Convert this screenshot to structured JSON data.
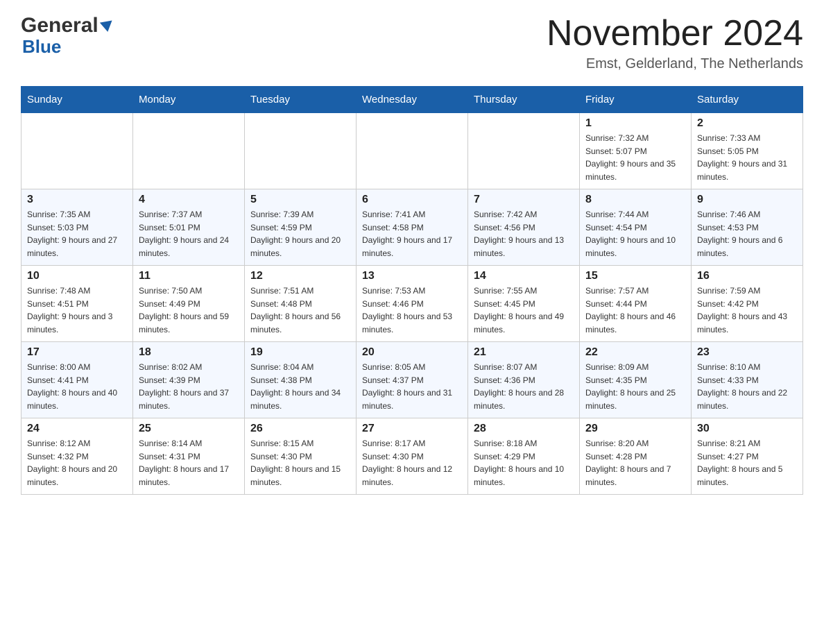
{
  "header": {
    "logo_general": "General",
    "logo_blue": "Blue",
    "month_title": "November 2024",
    "location": "Emst, Gelderland, The Netherlands"
  },
  "weekdays": [
    "Sunday",
    "Monday",
    "Tuesday",
    "Wednesday",
    "Thursday",
    "Friday",
    "Saturday"
  ],
  "rows": [
    [
      {
        "day": "",
        "sunrise": "",
        "sunset": "",
        "daylight": ""
      },
      {
        "day": "",
        "sunrise": "",
        "sunset": "",
        "daylight": ""
      },
      {
        "day": "",
        "sunrise": "",
        "sunset": "",
        "daylight": ""
      },
      {
        "day": "",
        "sunrise": "",
        "sunset": "",
        "daylight": ""
      },
      {
        "day": "",
        "sunrise": "",
        "sunset": "",
        "daylight": ""
      },
      {
        "day": "1",
        "sunrise": "Sunrise: 7:32 AM",
        "sunset": "Sunset: 5:07 PM",
        "daylight": "Daylight: 9 hours and 35 minutes."
      },
      {
        "day": "2",
        "sunrise": "Sunrise: 7:33 AM",
        "sunset": "Sunset: 5:05 PM",
        "daylight": "Daylight: 9 hours and 31 minutes."
      }
    ],
    [
      {
        "day": "3",
        "sunrise": "Sunrise: 7:35 AM",
        "sunset": "Sunset: 5:03 PM",
        "daylight": "Daylight: 9 hours and 27 minutes."
      },
      {
        "day": "4",
        "sunrise": "Sunrise: 7:37 AM",
        "sunset": "Sunset: 5:01 PM",
        "daylight": "Daylight: 9 hours and 24 minutes."
      },
      {
        "day": "5",
        "sunrise": "Sunrise: 7:39 AM",
        "sunset": "Sunset: 4:59 PM",
        "daylight": "Daylight: 9 hours and 20 minutes."
      },
      {
        "day": "6",
        "sunrise": "Sunrise: 7:41 AM",
        "sunset": "Sunset: 4:58 PM",
        "daylight": "Daylight: 9 hours and 17 minutes."
      },
      {
        "day": "7",
        "sunrise": "Sunrise: 7:42 AM",
        "sunset": "Sunset: 4:56 PM",
        "daylight": "Daylight: 9 hours and 13 minutes."
      },
      {
        "day": "8",
        "sunrise": "Sunrise: 7:44 AM",
        "sunset": "Sunset: 4:54 PM",
        "daylight": "Daylight: 9 hours and 10 minutes."
      },
      {
        "day": "9",
        "sunrise": "Sunrise: 7:46 AM",
        "sunset": "Sunset: 4:53 PM",
        "daylight": "Daylight: 9 hours and 6 minutes."
      }
    ],
    [
      {
        "day": "10",
        "sunrise": "Sunrise: 7:48 AM",
        "sunset": "Sunset: 4:51 PM",
        "daylight": "Daylight: 9 hours and 3 minutes."
      },
      {
        "day": "11",
        "sunrise": "Sunrise: 7:50 AM",
        "sunset": "Sunset: 4:49 PM",
        "daylight": "Daylight: 8 hours and 59 minutes."
      },
      {
        "day": "12",
        "sunrise": "Sunrise: 7:51 AM",
        "sunset": "Sunset: 4:48 PM",
        "daylight": "Daylight: 8 hours and 56 minutes."
      },
      {
        "day": "13",
        "sunrise": "Sunrise: 7:53 AM",
        "sunset": "Sunset: 4:46 PM",
        "daylight": "Daylight: 8 hours and 53 minutes."
      },
      {
        "day": "14",
        "sunrise": "Sunrise: 7:55 AM",
        "sunset": "Sunset: 4:45 PM",
        "daylight": "Daylight: 8 hours and 49 minutes."
      },
      {
        "day": "15",
        "sunrise": "Sunrise: 7:57 AM",
        "sunset": "Sunset: 4:44 PM",
        "daylight": "Daylight: 8 hours and 46 minutes."
      },
      {
        "day": "16",
        "sunrise": "Sunrise: 7:59 AM",
        "sunset": "Sunset: 4:42 PM",
        "daylight": "Daylight: 8 hours and 43 minutes."
      }
    ],
    [
      {
        "day": "17",
        "sunrise": "Sunrise: 8:00 AM",
        "sunset": "Sunset: 4:41 PM",
        "daylight": "Daylight: 8 hours and 40 minutes."
      },
      {
        "day": "18",
        "sunrise": "Sunrise: 8:02 AM",
        "sunset": "Sunset: 4:39 PM",
        "daylight": "Daylight: 8 hours and 37 minutes."
      },
      {
        "day": "19",
        "sunrise": "Sunrise: 8:04 AM",
        "sunset": "Sunset: 4:38 PM",
        "daylight": "Daylight: 8 hours and 34 minutes."
      },
      {
        "day": "20",
        "sunrise": "Sunrise: 8:05 AM",
        "sunset": "Sunset: 4:37 PM",
        "daylight": "Daylight: 8 hours and 31 minutes."
      },
      {
        "day": "21",
        "sunrise": "Sunrise: 8:07 AM",
        "sunset": "Sunset: 4:36 PM",
        "daylight": "Daylight: 8 hours and 28 minutes."
      },
      {
        "day": "22",
        "sunrise": "Sunrise: 8:09 AM",
        "sunset": "Sunset: 4:35 PM",
        "daylight": "Daylight: 8 hours and 25 minutes."
      },
      {
        "day": "23",
        "sunrise": "Sunrise: 8:10 AM",
        "sunset": "Sunset: 4:33 PM",
        "daylight": "Daylight: 8 hours and 22 minutes."
      }
    ],
    [
      {
        "day": "24",
        "sunrise": "Sunrise: 8:12 AM",
        "sunset": "Sunset: 4:32 PM",
        "daylight": "Daylight: 8 hours and 20 minutes."
      },
      {
        "day": "25",
        "sunrise": "Sunrise: 8:14 AM",
        "sunset": "Sunset: 4:31 PM",
        "daylight": "Daylight: 8 hours and 17 minutes."
      },
      {
        "day": "26",
        "sunrise": "Sunrise: 8:15 AM",
        "sunset": "Sunset: 4:30 PM",
        "daylight": "Daylight: 8 hours and 15 minutes."
      },
      {
        "day": "27",
        "sunrise": "Sunrise: 8:17 AM",
        "sunset": "Sunset: 4:30 PM",
        "daylight": "Daylight: 8 hours and 12 minutes."
      },
      {
        "day": "28",
        "sunrise": "Sunrise: 8:18 AM",
        "sunset": "Sunset: 4:29 PM",
        "daylight": "Daylight: 8 hours and 10 minutes."
      },
      {
        "day": "29",
        "sunrise": "Sunrise: 8:20 AM",
        "sunset": "Sunset: 4:28 PM",
        "daylight": "Daylight: 8 hours and 7 minutes."
      },
      {
        "day": "30",
        "sunrise": "Sunrise: 8:21 AM",
        "sunset": "Sunset: 4:27 PM",
        "daylight": "Daylight: 8 hours and 5 minutes."
      }
    ]
  ]
}
